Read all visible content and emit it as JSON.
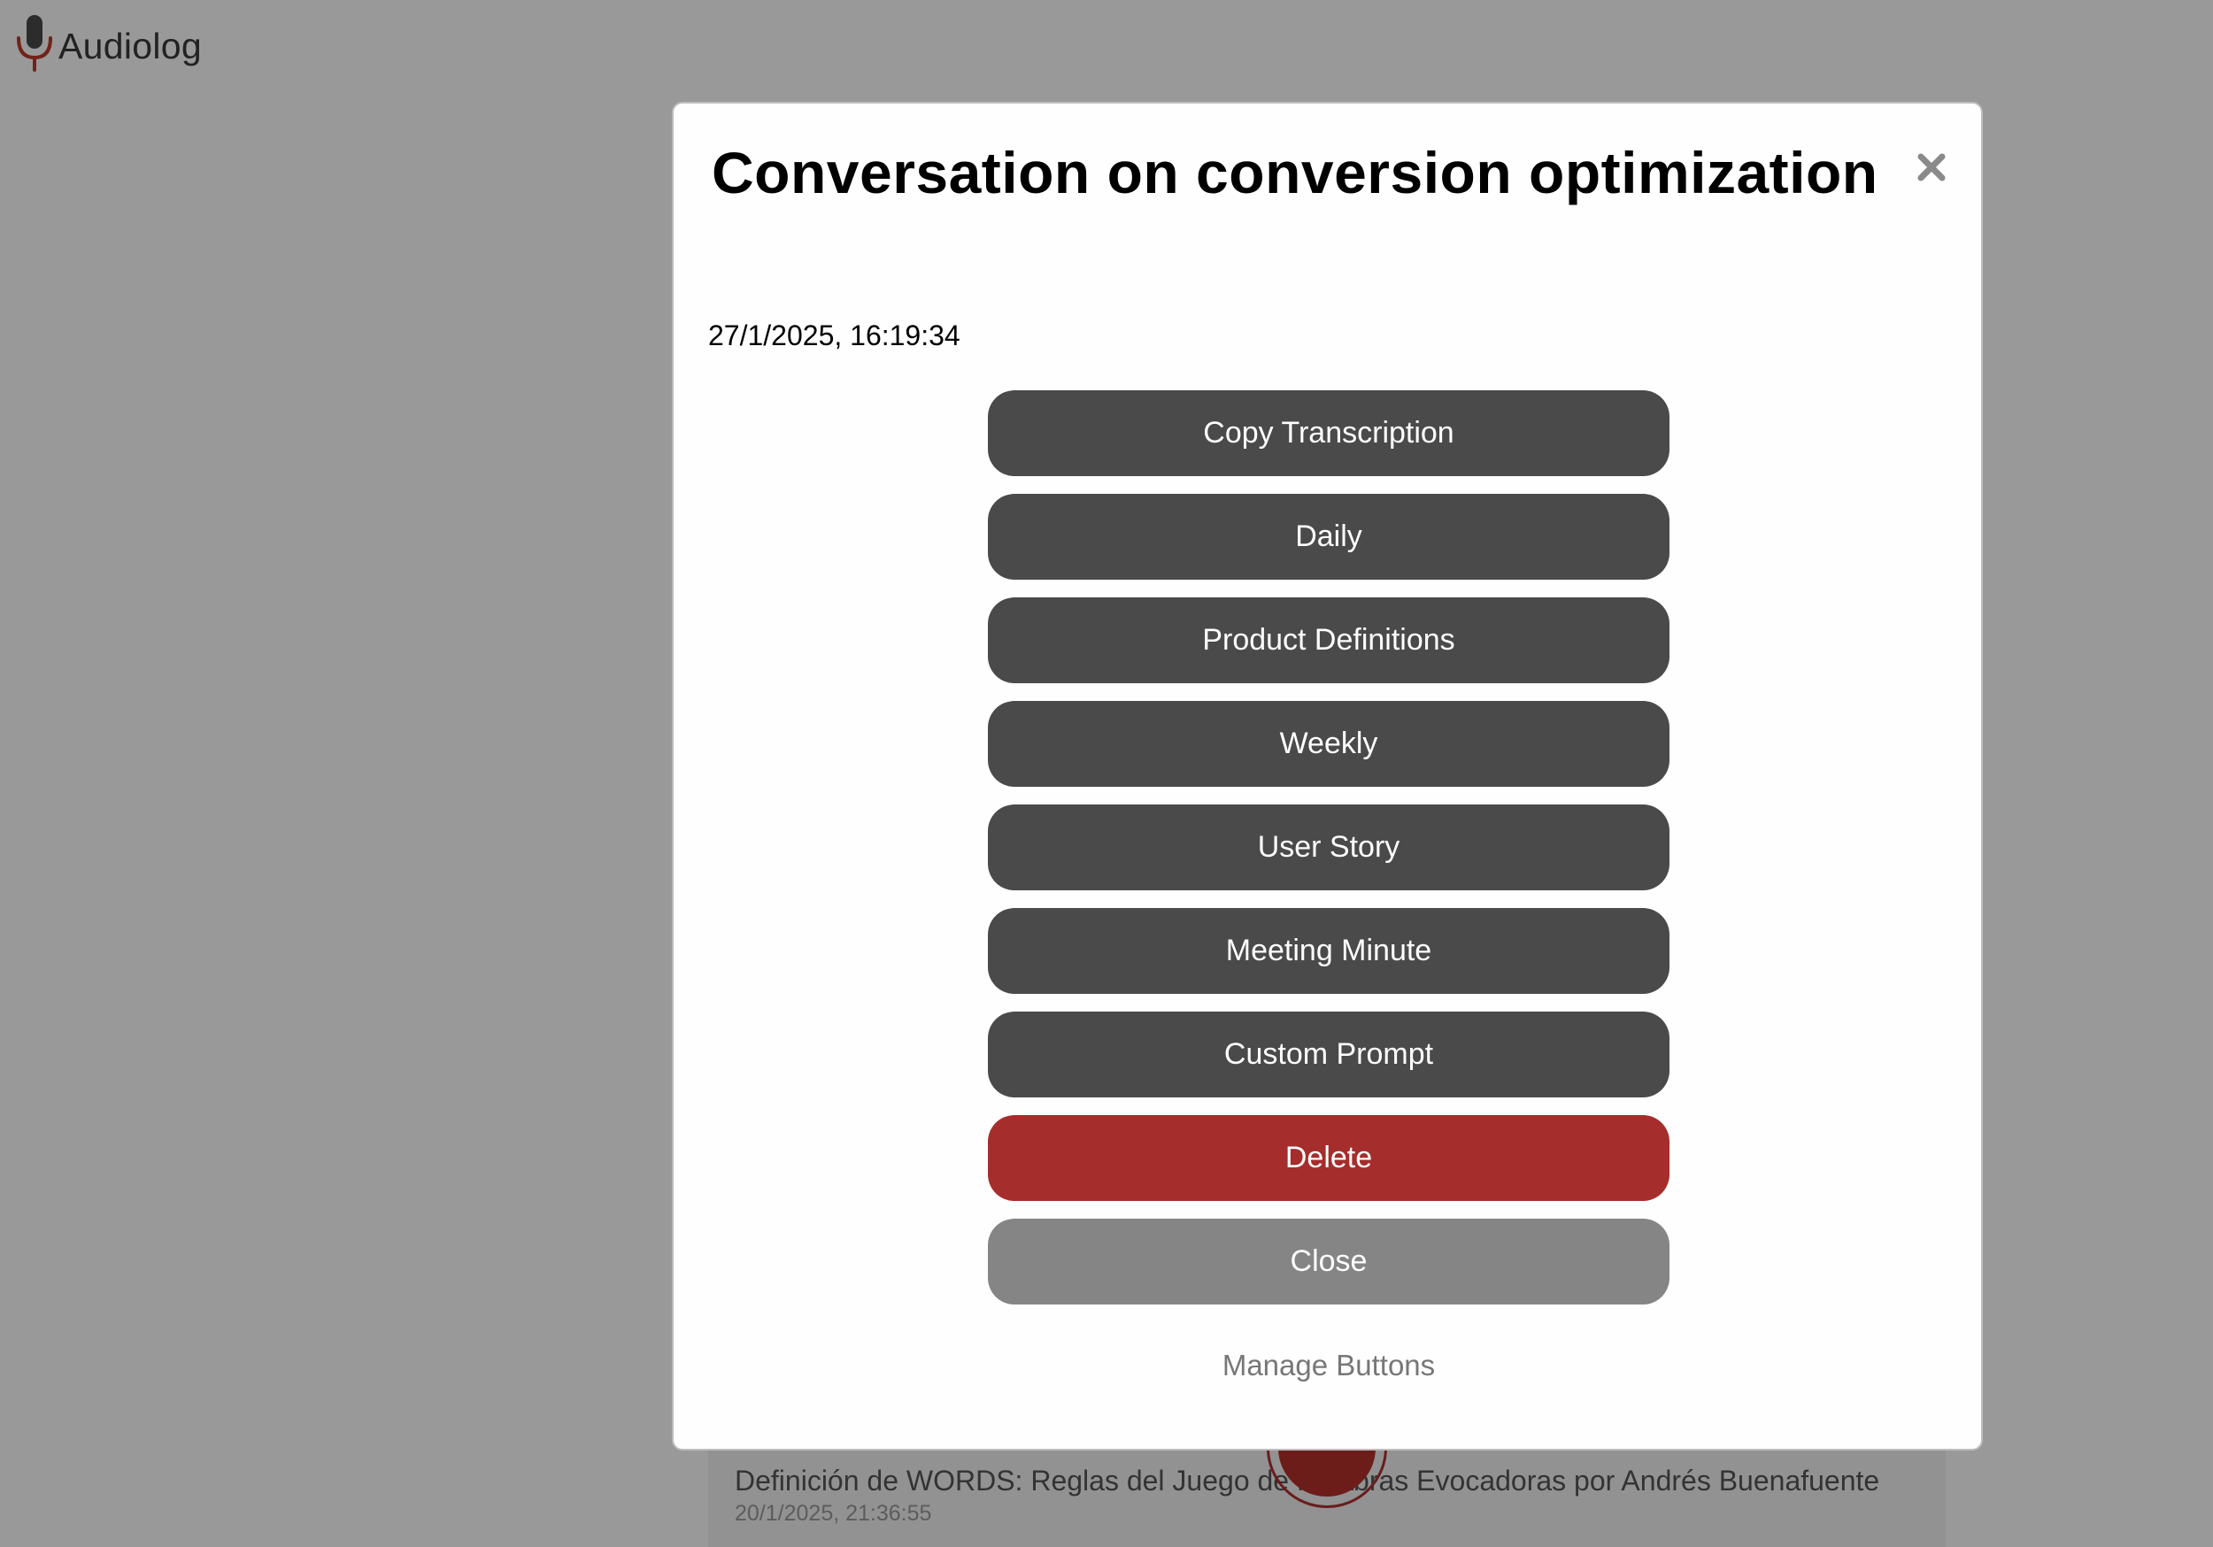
{
  "app": {
    "name": "Audiolog"
  },
  "background_list": {
    "items": [
      {
        "title": "Definición de WORDS: Reglas del Juego de Palabras Evocadoras por Andrés Buenafuente",
        "date": "20/1/2025, 21:36:55"
      }
    ]
  },
  "modal": {
    "title": "Conversation on conversion optimization",
    "date": "27/1/2025, 16:19:34",
    "buttons": [
      {
        "label": "Copy Transcription",
        "style": "dark"
      },
      {
        "label": "Daily",
        "style": "dark"
      },
      {
        "label": "Product Definitions",
        "style": "dark"
      },
      {
        "label": "Weekly",
        "style": "dark"
      },
      {
        "label": "User Story",
        "style": "dark"
      },
      {
        "label": "Meeting Minute",
        "style": "dark"
      },
      {
        "label": "Custom Prompt",
        "style": "dark"
      },
      {
        "label": "Delete",
        "style": "danger"
      },
      {
        "label": "Close",
        "style": "secondary"
      },
      {
        "label": "Manage Buttons",
        "style": "link"
      }
    ]
  },
  "icons": {
    "logo": "microphone-icon",
    "modal_close": "close-icon"
  },
  "colors": {
    "dark_button": "#4a4a4a",
    "danger_button": "#a52d2b",
    "secondary_button": "#858585",
    "logo_mic_stand": "#c0392b",
    "record_button": "#b5312c"
  }
}
